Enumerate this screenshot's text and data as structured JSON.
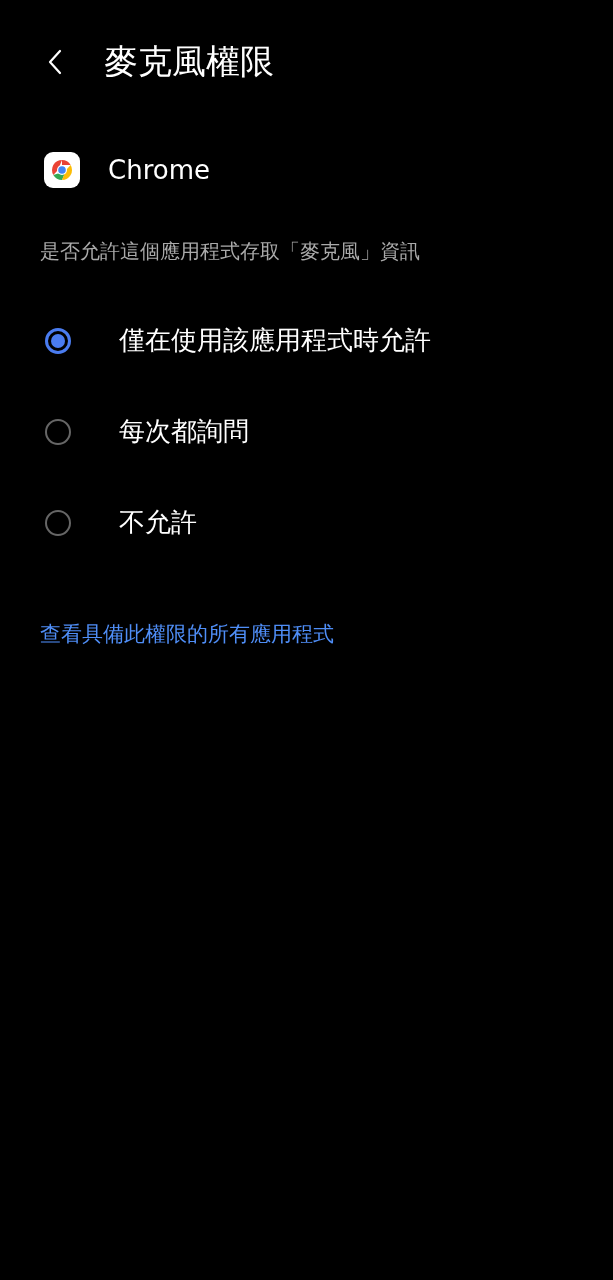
{
  "header": {
    "title": "麥克風權限"
  },
  "app": {
    "name": "Chrome"
  },
  "question": "是否允許這個應用程式存取「麥克風」資訊",
  "options": [
    {
      "label": "僅在使用該應用程式時允許",
      "selected": true
    },
    {
      "label": "每次都詢問",
      "selected": false
    },
    {
      "label": "不允許",
      "selected": false
    }
  ],
  "link": "查看具備此權限的所有應用程式"
}
